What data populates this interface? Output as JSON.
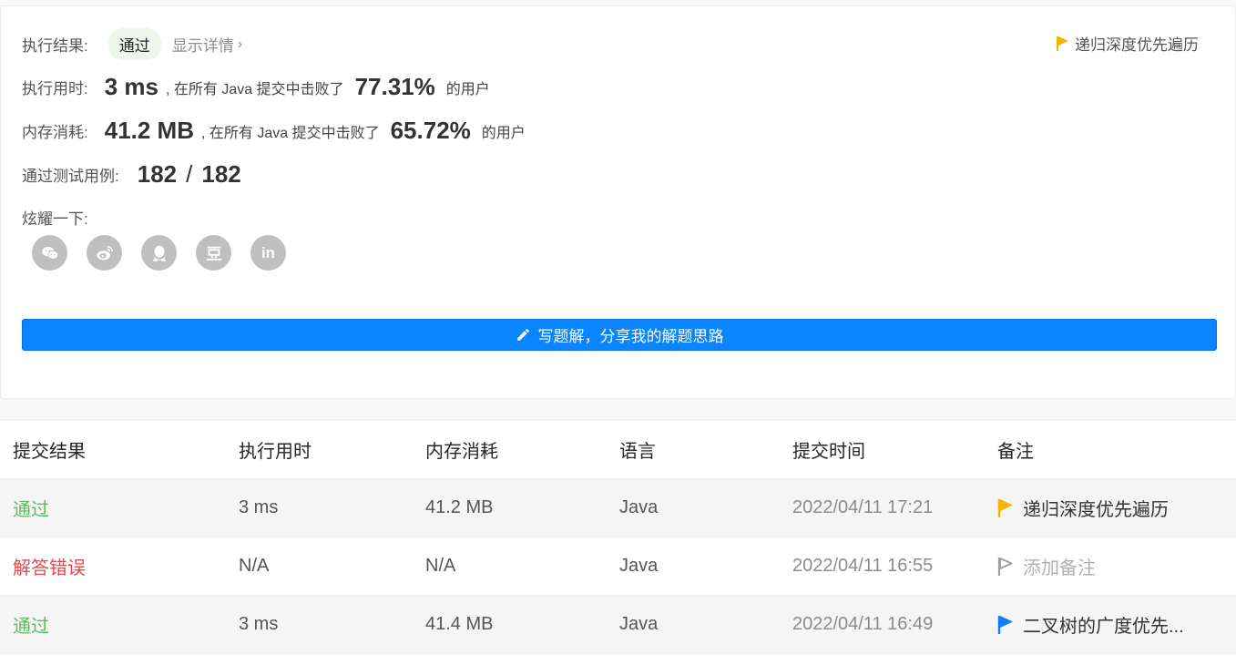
{
  "summary": {
    "result_label": "执行结果:",
    "result_value": "通过",
    "detail_link": "显示详情",
    "note_label": "递归深度优先遍历",
    "runtime_label": "执行用时:",
    "runtime_value": "3 ms",
    "runtime_text": ", 在所有 Java 提交中击败了",
    "runtime_percent": "77.31%",
    "runtime_suffix": "的用户",
    "memory_label": "内存消耗:",
    "memory_value": "41.2 MB",
    "memory_text": ", 在所有 Java 提交中击败了",
    "memory_percent": "65.72%",
    "memory_suffix": "的用户",
    "tests_label": "通过测试用例:",
    "tests_passed": "182",
    "tests_sep": "/",
    "tests_total": "182",
    "share_label": "炫耀一下:",
    "share_icons": [
      "wechat-icon",
      "weibo-icon",
      "qq-icon",
      "douban-icon",
      "linkedin-icon"
    ],
    "linkedin_text": "in",
    "write_button": "写题解，分享我的解题思路"
  },
  "table": {
    "headers": [
      "提交结果",
      "执行用时",
      "内存消耗",
      "语言",
      "提交时间",
      "备注"
    ],
    "rows": [
      {
        "status": "通过",
        "runtime": "3 ms",
        "memory": "41.2 MB",
        "lang": "Java",
        "time": "2022/04/11 17:21",
        "note": "递归深度优先遍历",
        "flag": "yellow"
      },
      {
        "status": "解答错误",
        "runtime": "N/A",
        "memory": "N/A",
        "lang": "Java",
        "time": "2022/04/11 16:55",
        "note": "添加备注",
        "flag": "outline"
      },
      {
        "status": "通过",
        "runtime": "3 ms",
        "memory": "41.4 MB",
        "lang": "Java",
        "time": "2022/04/11 16:49",
        "note": "二叉树的广度优先...",
        "flag": "blue"
      }
    ]
  },
  "colors": {
    "accent": "#0a84ff",
    "pass": "#5eb95e",
    "fail": "#e5484d",
    "flag_yellow": "#f5b400",
    "flag_blue": "#1677ff",
    "flag_outline": "#9e9e9e"
  }
}
